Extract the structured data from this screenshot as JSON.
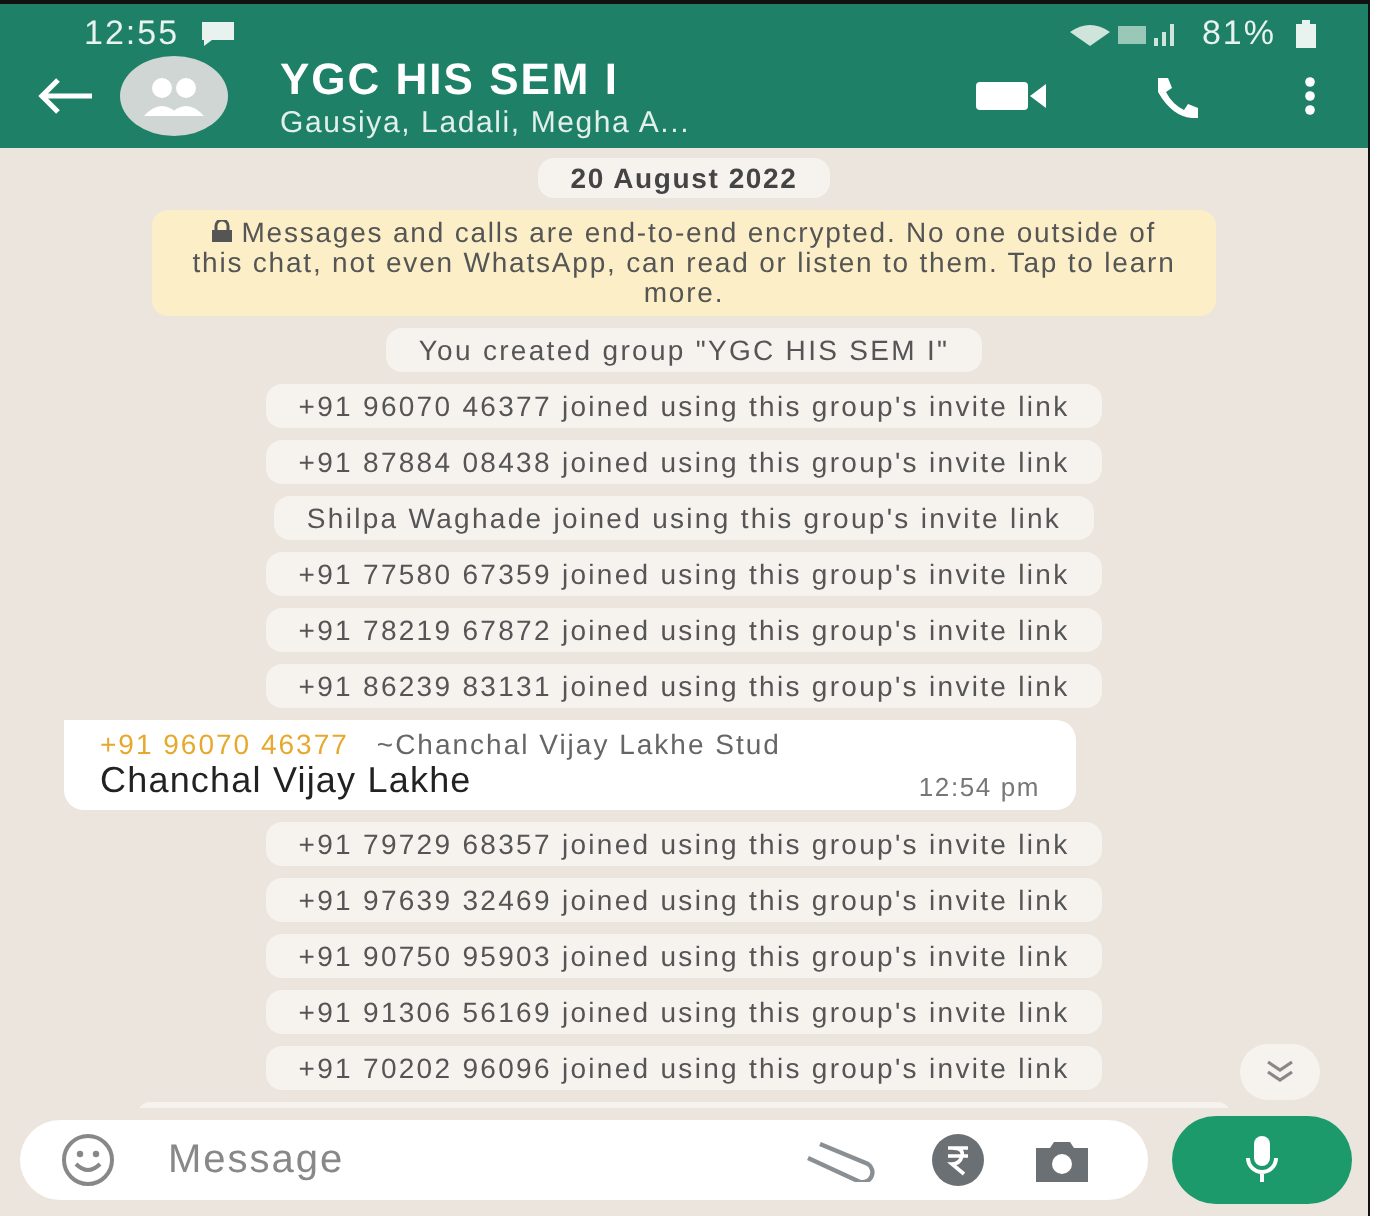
{
  "status_bar": {
    "time": "12:55",
    "battery": "81%"
  },
  "header": {
    "title": "YGC HIS SEM I",
    "subtitle": "Gausiya, Ladali, Megha A..."
  },
  "date_chip": "20 August 2022",
  "encryption_notice": "Messages and calls are end-to-end encrypted. No one outside of this chat, not even WhatsApp, can read or listen to them. Tap to learn more.",
  "messages": [
    {
      "kind": "system",
      "text": "You created group \"YGC HIS SEM I\""
    },
    {
      "kind": "system",
      "text": "+91 96070 46377 joined using this group's invite link"
    },
    {
      "kind": "system",
      "text": "+91 87884 08438 joined using this group's invite link"
    },
    {
      "kind": "system",
      "text": "Shilpa Waghade joined using this group's invite link"
    },
    {
      "kind": "system",
      "text": "+91 77580 67359 joined using this group's invite link"
    },
    {
      "kind": "system",
      "text": "+91 78219 67872 joined using this group's invite link"
    },
    {
      "kind": "system",
      "text": "+91 86239 83131 joined using this group's invite link"
    },
    {
      "kind": "incoming",
      "sender_phone": "+91 96070 46377",
      "sender_name": "~Chanchal Vijay Lakhe Stud",
      "text": "Chanchal Vijay Lakhe",
      "time": "12:54 pm"
    },
    {
      "kind": "system",
      "text": "+91 79729 68357 joined using this group's invite link"
    },
    {
      "kind": "system",
      "text": "+91 97639 32469 joined using this group's invite link"
    },
    {
      "kind": "system",
      "text": "+91 90750 95903 joined using this group's invite link"
    },
    {
      "kind": "system",
      "text": "+91 91306 56169 joined using this group's invite link"
    },
    {
      "kind": "system",
      "text": "+91 70202 96096 joined using this group's invite link"
    }
  ],
  "composer": {
    "placeholder": "Message"
  }
}
